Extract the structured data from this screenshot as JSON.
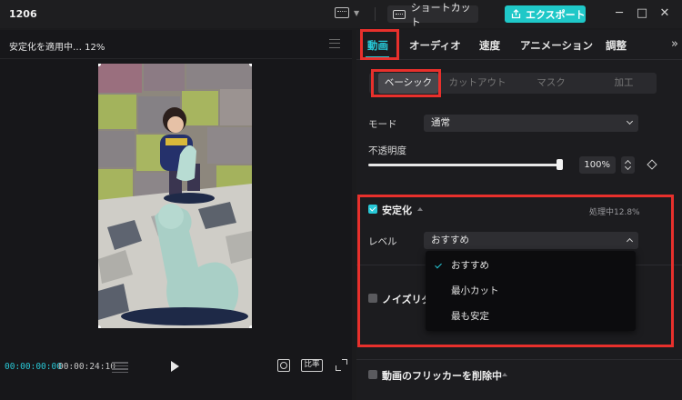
{
  "titlebar": {
    "app_title": "1206",
    "shortcut_label": "ショートカット",
    "export_label": "エクスポート"
  },
  "preview": {
    "title": "安定化を適用中… 12%",
    "time_current": "00:00:00:00",
    "time_total": "00:00:24:10",
    "ratio_label": "比率"
  },
  "inspector": {
    "tabs": [
      {
        "label": "動画",
        "active": true
      },
      {
        "label": "オーディオ"
      },
      {
        "label": "速度"
      },
      {
        "label": "アニメーション"
      },
      {
        "label": "調整"
      }
    ],
    "subtabs": [
      {
        "label": "ベーシック",
        "active": true
      },
      {
        "label": "カットアウト"
      },
      {
        "label": "マスク"
      },
      {
        "label": "加工"
      }
    ],
    "mode_label": "モード",
    "mode_value": "通常",
    "opacity_label": "不透明度",
    "opacity_value": "100%",
    "stabilize": {
      "title": "安定化",
      "checked": true,
      "status": "処理中12.8%",
      "level_label": "レベル",
      "level_value": "おすすめ",
      "options": [
        "おすすめ",
        "最小カット",
        "最も安定"
      ],
      "selected_option": "おすすめ"
    },
    "noise_reduction_title": "ノイズリダ",
    "flicker_title": "動画のフリッカーを削除中"
  },
  "colors": {
    "accent": "#27c8d7",
    "export": "#1fc8c8",
    "highlight": "#e8302c"
  }
}
